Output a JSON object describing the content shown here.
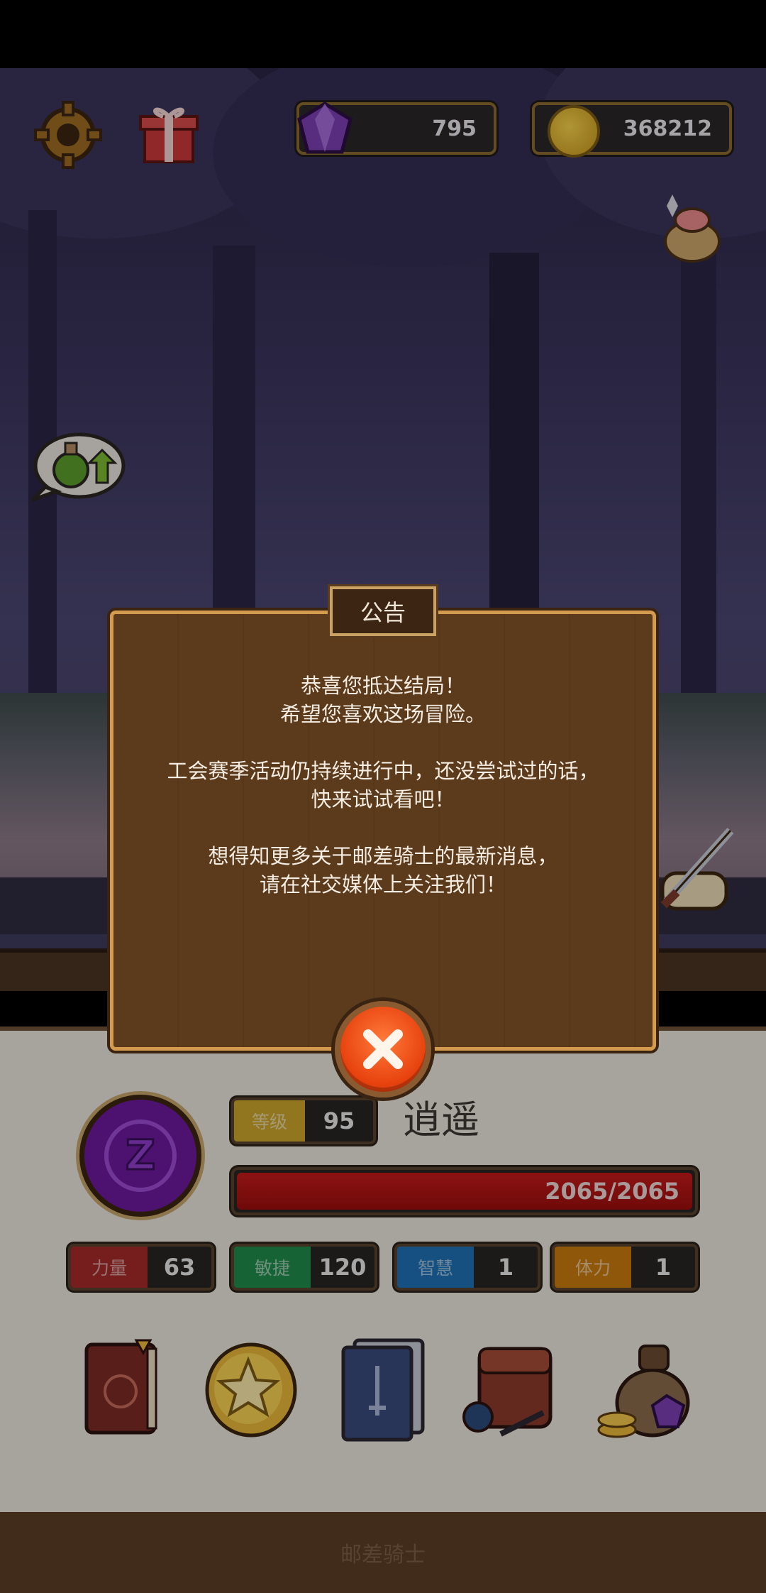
{
  "currencies": {
    "gems": "795",
    "gold": "368212"
  },
  "announcement": {
    "title": "公告",
    "lines": [
      "恭喜您抵达结局！",
      "希望您喜欢这场冒险。",
      "工会赛季活动仍持续进行中，还没尝试过的话，",
      "快来试试看吧！",
      "想得知更多关于邮差骑士的最新消息，",
      "请在社交媒体上关注我们！"
    ]
  },
  "player": {
    "level_label": "等级",
    "level": "95",
    "name": "逍遥",
    "hp": "2065/2065",
    "hp_fraction": 1.0
  },
  "stats": [
    {
      "label": "力量",
      "value": "63",
      "color": "#a42a2a"
    },
    {
      "label": "敏捷",
      "value": "120",
      "color": "#1f8a4a"
    },
    {
      "label": "智慧",
      "value": "1",
      "color": "#1f6fb2"
    },
    {
      "label": "体力",
      "value": "1",
      "color": "#c7790d"
    }
  ],
  "menu_icons": [
    "journal-book-icon",
    "star-coin-icon",
    "card-deck-icon",
    "backpack-icon",
    "treasure-bag-icon"
  ],
  "footer": {
    "title": "邮差骑士"
  },
  "colors": {
    "panel": "#e8e3da",
    "wood": "#5b3b1c",
    "frame": "#d49a4d",
    "close": "#e8430f"
  }
}
